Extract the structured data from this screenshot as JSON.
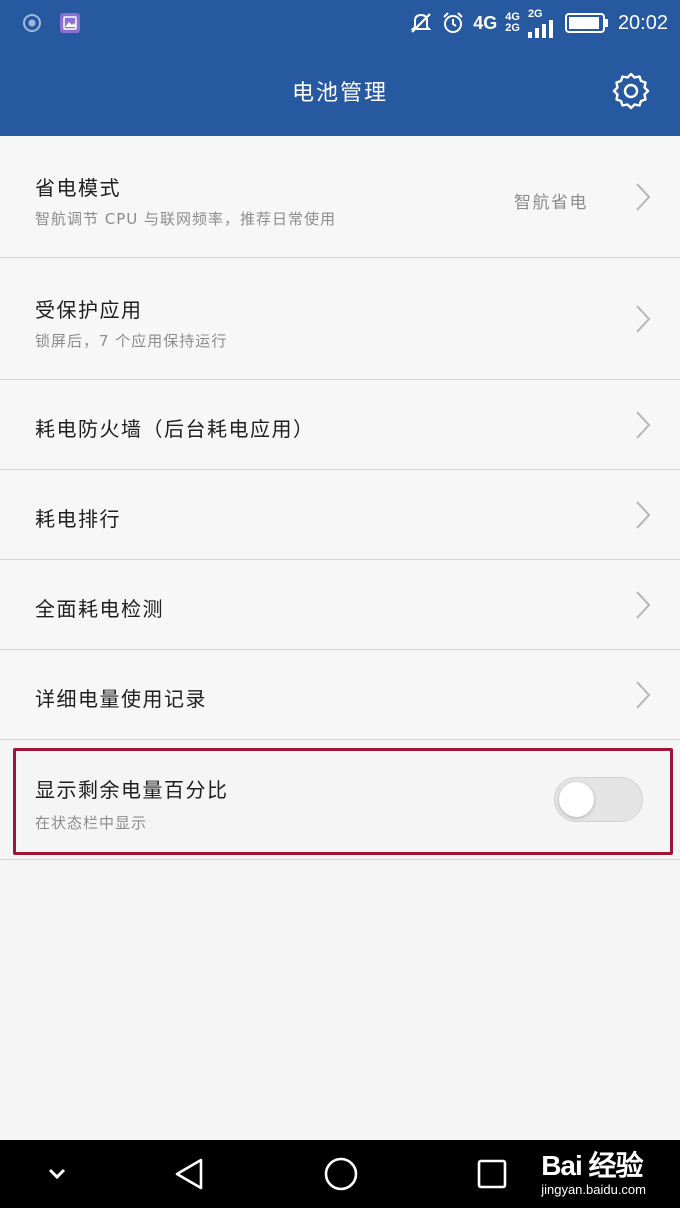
{
  "status_bar": {
    "network_main": "4G",
    "sim1_network": "4G",
    "sim2_network": "2G",
    "sim2_network_top": "2G",
    "time": "20:02",
    "icons": [
      "notification-circle-icon",
      "gallery-icon",
      "mute-icon",
      "alarm-icon",
      "signal-icon",
      "battery-icon"
    ]
  },
  "header": {
    "title": "电池管理",
    "settings_icon": "gear-icon"
  },
  "items": [
    {
      "title": "省电模式",
      "subtitle": "智航调节 CPU 与联网频率，推荐日常使用",
      "value": "智航省电"
    },
    {
      "title": "受保护应用",
      "subtitle": "锁屏后，7 个应用保持运行"
    },
    {
      "title": "耗电防火墙（后台耗电应用）"
    },
    {
      "title": "耗电排行"
    },
    {
      "title": "全面耗电检测"
    },
    {
      "title": "详细电量使用记录"
    }
  ],
  "toggle_item": {
    "title": "显示剩余电量百分比",
    "subtitle": "在状态栏中显示",
    "enabled": false
  },
  "nav_bar": {
    "watermark_brand": "Bai 经验",
    "watermark_url": "jingyan.baidu.com"
  },
  "colors": {
    "accent": "#2659a0",
    "highlight": "#9c1636",
    "background": "#f7f7f7"
  }
}
